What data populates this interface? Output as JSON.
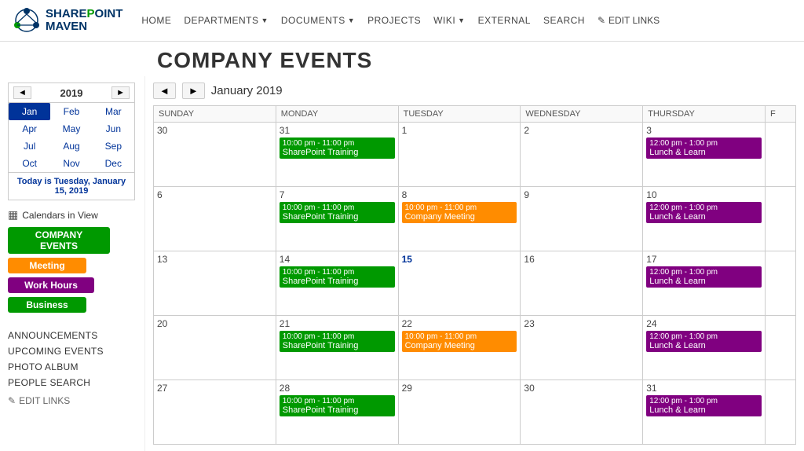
{
  "nav": {
    "home": "HOME",
    "departments": "DEPARTMENTS",
    "documents": "DOCUMENTS",
    "projects": "PROJECTS",
    "wiki": "WIKI",
    "external": "EXTERNAL",
    "search": "SEARCH",
    "edit_links": "EDIT LINKS"
  },
  "page": {
    "title": "COMPANY EVENTS"
  },
  "mini_cal": {
    "year": "2019",
    "months": [
      "Jan",
      "Feb",
      "Mar",
      "Apr",
      "May",
      "Jun",
      "Jul",
      "Aug",
      "Sep",
      "Oct",
      "Nov",
      "Dec"
    ],
    "today_text": "Today is Tuesday, January 15, 2019"
  },
  "calendars_section": {
    "label": "Calendars in View",
    "items": [
      {
        "name": "COMPANY EVENTS",
        "color_class": "cal-company"
      },
      {
        "name": "Meeting",
        "color_class": "cal-meeting"
      },
      {
        "name": "Work Hours",
        "color_class": "cal-workhours"
      },
      {
        "name": "Business",
        "color_class": "cal-business"
      }
    ]
  },
  "sidebar_links": [
    "ANNOUNCEMENTS",
    "UPCOMING EVENTS",
    "PHOTO ALBUM",
    "PEOPLE SEARCH"
  ],
  "cal_header": {
    "month_label": "January 2019"
  },
  "col_headers": [
    "SUNDAY",
    "MONDAY",
    "TUESDAY",
    "WEDNESDAY",
    "THURSDAY",
    "F"
  ],
  "weeks": [
    {
      "days": [
        {
          "num": "30",
          "events": []
        },
        {
          "num": "31",
          "events": [
            {
              "time": "10:00 pm - 11:00 pm",
              "title": "SharePoint Training",
              "color": "green"
            }
          ]
        },
        {
          "num": "1",
          "events": []
        },
        {
          "num": "2",
          "events": []
        },
        {
          "num": "3",
          "events": [
            {
              "time": "12:00 pm - 1:00 pm",
              "title": "Lunch & Learn",
              "color": "purple"
            }
          ]
        },
        {
          "num": "",
          "events": []
        }
      ]
    },
    {
      "days": [
        {
          "num": "6",
          "events": []
        },
        {
          "num": "7",
          "events": [
            {
              "time": "10:00 pm - 11:00 pm",
              "title": "SharePoint Training",
              "color": "green"
            }
          ]
        },
        {
          "num": "8",
          "events": [
            {
              "time": "10:00 pm - 11:00 pm",
              "title": "Company Meeting",
              "color": "orange"
            }
          ]
        },
        {
          "num": "9",
          "events": []
        },
        {
          "num": "10",
          "events": [
            {
              "time": "12:00 pm - 1:00 pm",
              "title": "Lunch & Learn",
              "color": "purple"
            }
          ]
        },
        {
          "num": "",
          "events": []
        }
      ]
    },
    {
      "days": [
        {
          "num": "13",
          "events": []
        },
        {
          "num": "14",
          "events": [
            {
              "time": "10:00 pm - 11:00 pm",
              "title": "SharePoint Training",
              "color": "green"
            }
          ]
        },
        {
          "num": "15",
          "events": [],
          "today": true
        },
        {
          "num": "16",
          "events": []
        },
        {
          "num": "17",
          "events": [
            {
              "time": "12:00 pm - 1:00 pm",
              "title": "Lunch & Learn",
              "color": "purple"
            }
          ]
        },
        {
          "num": "",
          "events": []
        }
      ]
    },
    {
      "days": [
        {
          "num": "20",
          "events": []
        },
        {
          "num": "21",
          "events": [
            {
              "time": "10:00 pm - 11:00 pm",
              "title": "SharePoint Training",
              "color": "green"
            }
          ]
        },
        {
          "num": "22",
          "events": [
            {
              "time": "10:00 pm - 11:00 pm",
              "title": "Company Meeting",
              "color": "orange"
            }
          ]
        },
        {
          "num": "23",
          "events": []
        },
        {
          "num": "24",
          "events": [
            {
              "time": "12:00 pm - 1:00 pm",
              "title": "Lunch & Learn",
              "color": "purple"
            }
          ]
        },
        {
          "num": "",
          "events": []
        }
      ]
    },
    {
      "days": [
        {
          "num": "27",
          "events": []
        },
        {
          "num": "28",
          "events": [
            {
              "time": "10:00 pm - 11:00 pm",
              "title": "SharePoint Training",
              "color": "green"
            }
          ]
        },
        {
          "num": "29",
          "events": []
        },
        {
          "num": "30",
          "events": []
        },
        {
          "num": "31",
          "events": [
            {
              "time": "12:00 pm - 1:00 pm",
              "title": "Lunch & Learn",
              "color": "purple"
            }
          ]
        },
        {
          "num": "",
          "events": []
        }
      ]
    }
  ]
}
